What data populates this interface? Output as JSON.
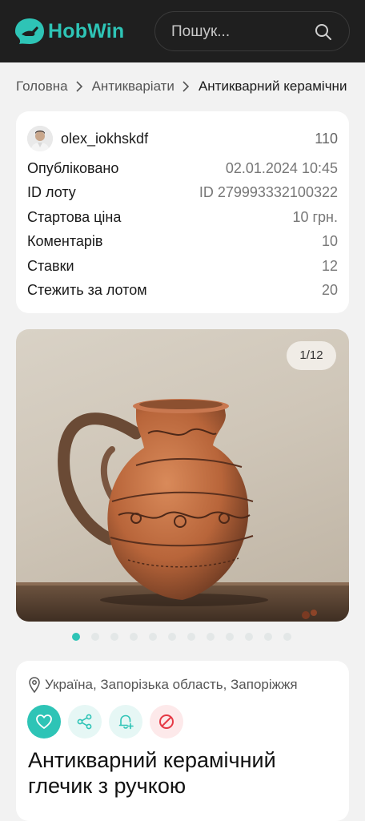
{
  "header": {
    "logo_text": "HobWin",
    "search_placeholder": "Пошук...",
    "colors": {
      "bar": "#1f1f1f",
      "accent": "#2ec4b6"
    }
  },
  "breadcrumb": {
    "items": [
      "Головна",
      "Антикваріати",
      "Антикварний керамічни"
    ]
  },
  "lot_info": {
    "seller_name": "olex_iokhskdf",
    "seller_rating": "110",
    "rows": [
      {
        "label": "Опубліковано",
        "value": "02.01.2024 10:45"
      },
      {
        "label": "ID лоту",
        "value": "ID 279993332100322"
      },
      {
        "label": "Стартова ціна",
        "value": "10 грн."
      },
      {
        "label": "Коментарів",
        "value": "10"
      },
      {
        "label": "Ставки",
        "value": "12"
      },
      {
        "label": "Стежить за лотом",
        "value": "20"
      }
    ]
  },
  "gallery": {
    "counter": "1/12",
    "total_dots": 12,
    "active_dot": 0
  },
  "details": {
    "location": "Україна, Запорізька область, Запоріжжя",
    "actions": [
      {
        "name": "favorite",
        "icon": "heart-icon",
        "bg": "#2ec4b6",
        "fg": "#ffffff"
      },
      {
        "name": "share",
        "icon": "share-icon",
        "bg": "#e6f7f5",
        "fg": "#2ec4b6"
      },
      {
        "name": "subscribe",
        "icon": "bell-plus-icon",
        "bg": "#e6f7f5",
        "fg": "#2ec4b6"
      },
      {
        "name": "report",
        "icon": "block-icon",
        "bg": "#fde9ea",
        "fg": "#e53945"
      }
    ],
    "title": "Антикварний керамічний глечик з ручкою"
  }
}
